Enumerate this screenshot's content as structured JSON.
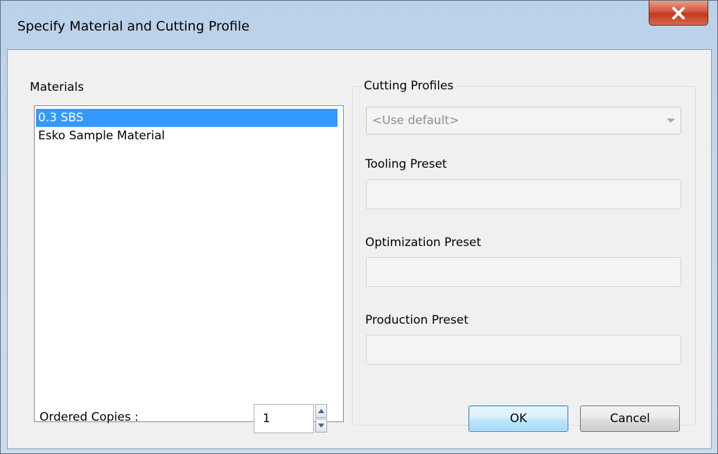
{
  "window": {
    "title": "Specify Material and Cutting Profile",
    "close_glyph": "x"
  },
  "materials": {
    "label": "Materials",
    "items": [
      {
        "label": "0.3 SBS",
        "selected": true
      },
      {
        "label": "Esko Sample Material",
        "selected": false
      }
    ]
  },
  "ordered_copies": {
    "label": "Ordered Copies :",
    "value": "1"
  },
  "cutting_profiles": {
    "group_label": "Cutting Profiles",
    "selected_value": "<Use default>",
    "tooling_label": "Tooling Preset",
    "tooling_value": "",
    "optimization_label": "Optimization Preset",
    "optimization_value": "",
    "production_label": "Production Preset",
    "production_value": ""
  },
  "buttons": {
    "ok": "OK",
    "cancel": "Cancel"
  },
  "colors": {
    "selection": "#3399ff",
    "close_button": "#c23a22",
    "dialog_bg": "#f0f0f0"
  }
}
